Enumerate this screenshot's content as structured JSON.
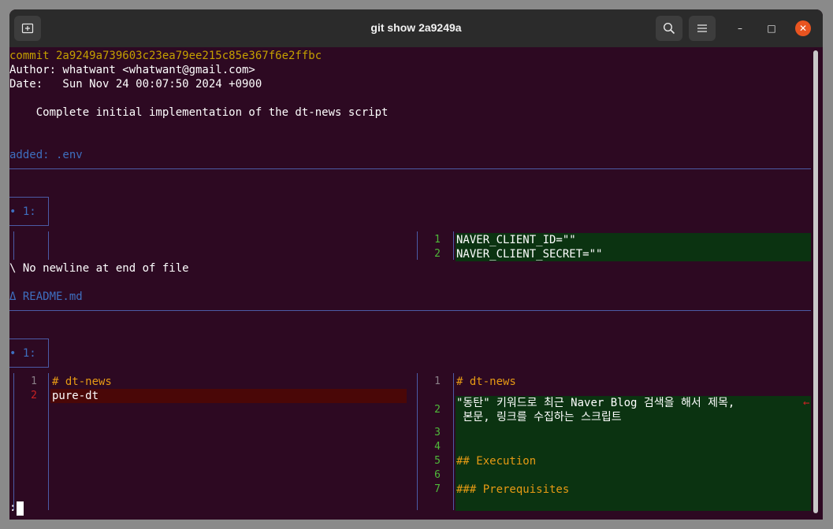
{
  "window": {
    "title": "git show 2a9249a",
    "new_tab_icon": "new-tab-icon",
    "search_icon": "search-icon",
    "menu_icon": "hamburger-menu-icon",
    "minimize_glyph": "–",
    "maximize_glyph": "□",
    "close_glyph": "✕"
  },
  "commit": {
    "line": "commit 2a9249a739603c23ea79ee215c85e367f6e2ffbc",
    "author": "Author: whatwant <whatwant@gmail.com>",
    "date": "Date:   Sun Nov 24 00:07:50 2024 +0900",
    "message": "    Complete initial implementation of the dt-news script"
  },
  "file1": {
    "header": "added: .env",
    "hunk": "• 1:",
    "right_lines": [
      {
        "num": "1",
        "text": "NAVER_CLIENT_ID=\"\""
      },
      {
        "num": "2",
        "text": "NAVER_CLIENT_SECRET=\"\""
      }
    ],
    "no_newline": "\\ No newline at end of file"
  },
  "file2": {
    "header": "Δ README.md",
    "hunk": "• 1:",
    "left_lines": [
      {
        "num": "1",
        "text": "# dt-news"
      },
      {
        "num": "2",
        "text": "pure-dt"
      }
    ],
    "right_lines": [
      {
        "num": "1",
        "text": "# dt-news"
      },
      {
        "num": "2",
        "text": "\"동탄\" 키워드로 최근 Naver Blog 검색을 해서 제목,",
        "wrap_marker": "←",
        "cont": " 본문, 링크를 수집하는 스크립트"
      },
      {
        "num": "3",
        "text": ""
      },
      {
        "num": "4",
        "text": ""
      },
      {
        "num": "5",
        "text": "## Execution"
      },
      {
        "num": "6",
        "text": ""
      },
      {
        "num": "7",
        "text": "### Prerequisites"
      }
    ]
  },
  "prompt": ":",
  "colors": {
    "background": "#2d0922",
    "added_bg": "#0b3311",
    "removed_bg": "#4a0707",
    "commit_yellow": "#c4a000",
    "file_header_blue": "#3e6fbf",
    "heading_orange": "#e69a14"
  }
}
